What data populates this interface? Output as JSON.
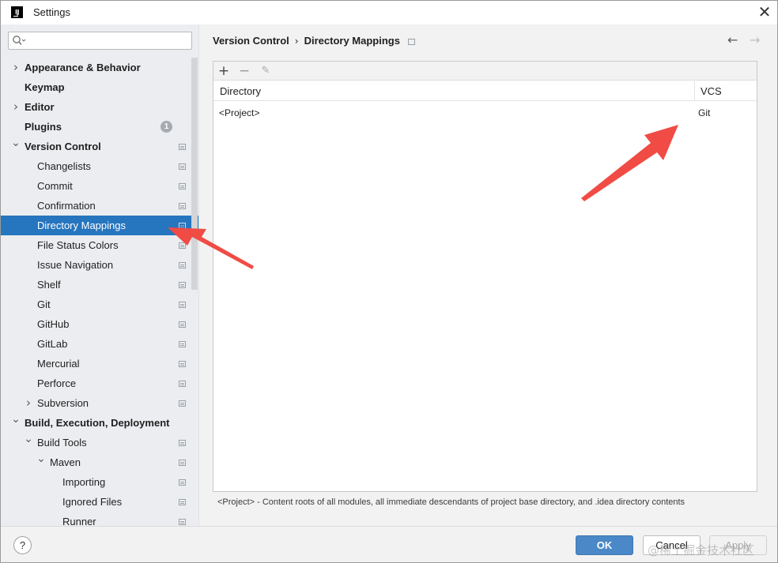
{
  "window": {
    "title": "Settings",
    "logo_text": "IJ"
  },
  "search": {
    "placeholder": "",
    "value": ""
  },
  "sidebar": {
    "items": [
      {
        "label": "Appearance & Behavior",
        "bold": true,
        "arrow": "right",
        "level": 0
      },
      {
        "label": "Keymap",
        "bold": true,
        "arrow": "",
        "level": 0
      },
      {
        "label": "Editor",
        "bold": true,
        "arrow": "right",
        "level": 0
      },
      {
        "label": "Plugins",
        "bold": true,
        "arrow": "",
        "level": 0,
        "badge": "1"
      },
      {
        "label": "Version Control",
        "bold": true,
        "arrow": "down",
        "level": 0,
        "proj": true
      },
      {
        "label": "Changelists",
        "level": 1,
        "proj": true
      },
      {
        "label": "Commit",
        "level": 1,
        "proj": true
      },
      {
        "label": "Confirmation",
        "level": 1,
        "proj": true
      },
      {
        "label": "Directory Mappings",
        "level": 1,
        "proj": true,
        "selected": true
      },
      {
        "label": "File Status Colors",
        "level": 1,
        "proj": true
      },
      {
        "label": "Issue Navigation",
        "level": 1,
        "proj": true
      },
      {
        "label": "Shelf",
        "level": 1,
        "proj": true
      },
      {
        "label": "Git",
        "level": 1,
        "proj": true
      },
      {
        "label": "GitHub",
        "level": 1,
        "proj": true
      },
      {
        "label": "GitLab",
        "level": 1,
        "proj": true
      },
      {
        "label": "Mercurial",
        "level": 1,
        "proj": true
      },
      {
        "label": "Perforce",
        "level": 1,
        "proj": true
      },
      {
        "label": "Subversion",
        "level": 1,
        "arrow": "right",
        "proj": true
      },
      {
        "label": "Build, Execution, Deployment",
        "bold": true,
        "arrow": "down",
        "level": 0
      },
      {
        "label": "Build Tools",
        "level": 1,
        "arrow": "down",
        "proj": true
      },
      {
        "label": "Maven",
        "level": 2,
        "arrow": "down",
        "proj": true
      },
      {
        "label": "Importing",
        "level": 3,
        "proj": true
      },
      {
        "label": "Ignored Files",
        "level": 3,
        "proj": true
      },
      {
        "label": "Runner",
        "level": 3,
        "proj": true
      }
    ]
  },
  "breadcrumb": {
    "parent": "Version Control",
    "separator": "›",
    "current": "Directory Mappings"
  },
  "nav": {
    "back": "←",
    "forward": "→"
  },
  "toolbar": {
    "add": "+",
    "remove": "−",
    "edit": "✎"
  },
  "table": {
    "columns": [
      "Directory",
      "VCS"
    ],
    "rows": [
      {
        "directory": "<Project>",
        "vcs": "Git"
      }
    ]
  },
  "footnote": "<Project> - Content roots of all modules, all immediate descendants of project base directory, and .idea directory contents",
  "buttons": {
    "help": "?",
    "ok": "OK",
    "cancel": "Cancel",
    "apply": "Apply"
  },
  "watermark": "@稀土掘金技术社区",
  "colors": {
    "selection": "#2675bf",
    "ok_button": "#4a88c7",
    "annotation_arrow": "#f04b45"
  }
}
